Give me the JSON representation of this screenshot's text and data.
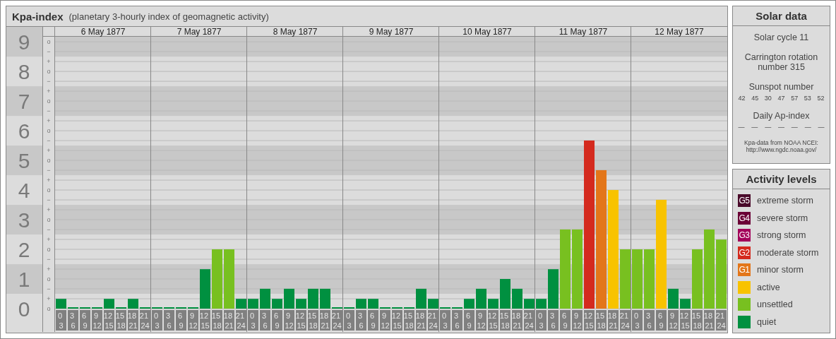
{
  "kpa": {
    "title": "Kpa-index",
    "subtitle": "(planetary 3-hourly index of geomagnetic activity)",
    "days": [
      {
        "date": "6 May 1877"
      },
      {
        "date": "7 May 1877"
      },
      {
        "date": "8 May 1877"
      },
      {
        "date": "9 May 1877"
      },
      {
        "date": "10 May 1877"
      },
      {
        "date": "11 May 1877"
      },
      {
        "date": "12 May 1877"
      }
    ],
    "y_minor_ticks": [
      "o",
      "−",
      "+",
      "o",
      "−",
      "+",
      "o",
      "−",
      "+",
      "o",
      "−",
      "+",
      "o",
      "−",
      "+",
      "o",
      "−",
      "+",
      "o",
      "−",
      "+",
      "o",
      "−",
      "+",
      "o",
      "−",
      "+",
      "o"
    ],
    "chart_data": {
      "type": "bar",
      "ylim": [
        0,
        9.17
      ],
      "yticks": [
        0,
        1,
        2,
        3,
        4,
        5,
        6,
        7,
        8,
        9
      ],
      "grid": true,
      "categories": [
        "0 3",
        "3 6",
        "6 9",
        "9 12",
        "12 15",
        "15 18",
        "18 21",
        "21 24",
        "0 3",
        "3 6",
        "6 9",
        "9 12",
        "12 15",
        "15 18",
        "18 21",
        "21 24",
        "0 3",
        "3 6",
        "6 9",
        "9 12",
        "12 15",
        "15 18",
        "18 21",
        "21 24",
        "0 3",
        "3 6",
        "6 9",
        "9 12",
        "12 15",
        "15 18",
        "18 21",
        "21 24",
        "0 3",
        "3 6",
        "6 9",
        "9 12",
        "12 15",
        "15 18",
        "18 21",
        "21 24",
        "0 3",
        "3 6",
        "6 9",
        "9 12",
        "12 15",
        "15 18",
        "18 21",
        "21 24",
        "0 3",
        "3 6",
        "6 9",
        "9 12",
        "12 15",
        "15 18",
        "18 21",
        "21 24"
      ],
      "series": [
        {
          "color": "#009040",
          "values": [
            0.33,
            0,
            0,
            0,
            0.33,
            0,
            0.33,
            0,
            0,
            0,
            0,
            0,
            1.33,
            null,
            null,
            0.33,
            0.33,
            0.67,
            0.33,
            0.67,
            0.33,
            0.67,
            0.67,
            0,
            0,
            0.33,
            0.33,
            0,
            0,
            0,
            0.67,
            0.33,
            0,
            0,
            0.33,
            0.67,
            0.33,
            1,
            0.67,
            0.33,
            0.33,
            1.33,
            null,
            null,
            null,
            null,
            null,
            null,
            null,
            null,
            null,
            0.67,
            0.33,
            null,
            null,
            null
          ]
        },
        {
          "color": "#78c020",
          "values": [
            null,
            null,
            null,
            null,
            null,
            null,
            null,
            null,
            null,
            null,
            null,
            null,
            null,
            2,
            2,
            null,
            null,
            null,
            null,
            null,
            null,
            null,
            null,
            null,
            null,
            null,
            null,
            null,
            null,
            null,
            null,
            null,
            null,
            null,
            null,
            null,
            null,
            null,
            null,
            null,
            null,
            null,
            2.67,
            2.67,
            null,
            null,
            null,
            2,
            2,
            2,
            null,
            null,
            null,
            2,
            2.67,
            2.33
          ]
        },
        {
          "color": "#f8c300",
          "values": [
            null,
            null,
            null,
            null,
            null,
            null,
            null,
            null,
            null,
            null,
            null,
            null,
            null,
            null,
            null,
            null,
            null,
            null,
            null,
            null,
            null,
            null,
            null,
            null,
            null,
            null,
            null,
            null,
            null,
            null,
            null,
            null,
            null,
            null,
            null,
            null,
            null,
            null,
            null,
            null,
            null,
            null,
            null,
            null,
            null,
            null,
            4,
            null,
            null,
            null,
            3.67,
            null,
            null,
            null,
            null,
            null
          ]
        },
        {
          "color": "#e3761a",
          "values": [
            null,
            null,
            null,
            null,
            null,
            null,
            null,
            null,
            null,
            null,
            null,
            null,
            null,
            null,
            null,
            null,
            null,
            null,
            null,
            null,
            null,
            null,
            null,
            null,
            null,
            null,
            null,
            null,
            null,
            null,
            null,
            null,
            null,
            null,
            null,
            null,
            null,
            null,
            null,
            null,
            null,
            null,
            null,
            null,
            null,
            4.67,
            null,
            null,
            null,
            null,
            null,
            null,
            null,
            null,
            null,
            null
          ]
        },
        {
          "color": "#d42a1e",
          "values": [
            null,
            null,
            null,
            null,
            null,
            null,
            null,
            null,
            null,
            null,
            null,
            null,
            null,
            null,
            null,
            null,
            null,
            null,
            null,
            null,
            null,
            null,
            null,
            null,
            null,
            null,
            null,
            null,
            null,
            null,
            null,
            null,
            null,
            null,
            null,
            null,
            null,
            null,
            null,
            null,
            null,
            null,
            null,
            null,
            5.67,
            null,
            null,
            null,
            null,
            null,
            null,
            null,
            null,
            null,
            null,
            null
          ]
        }
      ]
    }
  },
  "solar_data": {
    "title": "Solar data",
    "solar_cycle": "Solar cycle 11",
    "carrington": "Carrington rotation number 315",
    "sunspot_label": "Sunspot number",
    "sunspot_numbers": [
      "42",
      "45",
      "30",
      "47",
      "57",
      "53",
      "52"
    ],
    "ap_label": "Daily Ap-index",
    "ap_values": [
      "—",
      "—",
      "—",
      "—",
      "—",
      "—",
      "—"
    ],
    "source_lines": [
      "Kpa-data from NOAA NCEI:",
      "http://www.ngdc.noaa.gov/"
    ]
  },
  "activity_levels": {
    "title": "Activity levels",
    "items": [
      {
        "badge": "G5",
        "label": "extreme storm",
        "color": "#4a0a2a"
      },
      {
        "badge": "G4",
        "label": "severe storm",
        "color": "#6b0036"
      },
      {
        "badge": "G3",
        "label": "strong storm",
        "color": "#a3005a"
      },
      {
        "badge": "G2",
        "label": "moderate storm",
        "color": "#d42a1e"
      },
      {
        "badge": "G1",
        "label": "minor storm",
        "color": "#e3761a"
      },
      {
        "label": "active",
        "color": "#f8c300"
      },
      {
        "label": "unsettled",
        "color": "#78c020"
      },
      {
        "label": "quiet",
        "color": "#009040"
      }
    ]
  }
}
